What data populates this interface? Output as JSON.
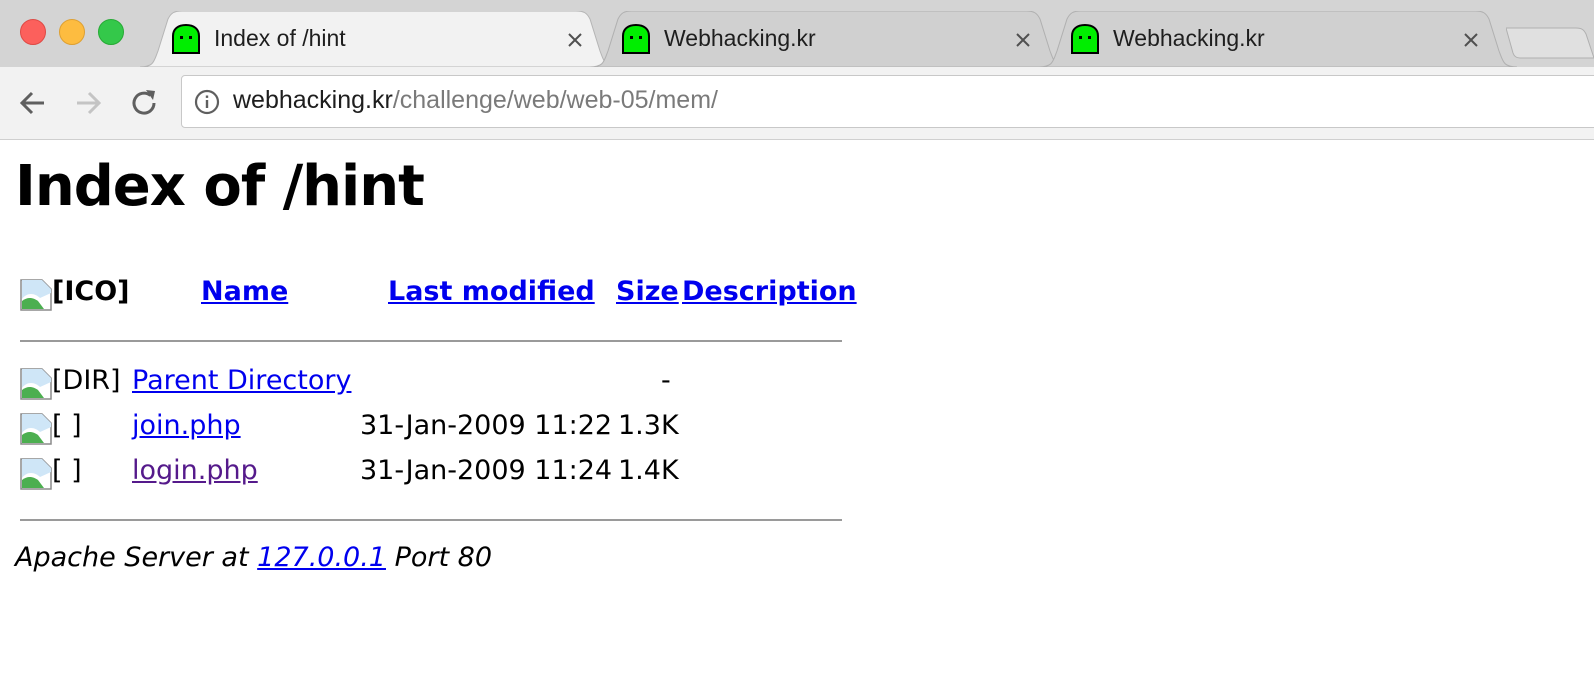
{
  "browser": {
    "tabs": [
      {
        "title": "Index of /hint",
        "active": true
      },
      {
        "title": "Webhacking.kr",
        "active": false
      },
      {
        "title": "Webhacking.kr",
        "active": false
      }
    ],
    "address_bar": {
      "host": "webhacking.kr",
      "path": "/challenge/web/web-05/mem/"
    }
  },
  "page": {
    "title": "Index of /hint",
    "table": {
      "header": {
        "icon_alt": "[ICO]",
        "name": "Name",
        "last_modified": "Last modified",
        "size": "Size",
        "description": "Description"
      },
      "rows": [
        {
          "icon_alt": "[DIR]",
          "name": "Parent Directory",
          "last_modified": "",
          "size": "-",
          "visited": false
        },
        {
          "icon_alt": "[ ]",
          "name": "join.php",
          "last_modified": "31-Jan-2009 11:22",
          "size": "1.3K",
          "visited": false
        },
        {
          "icon_alt": "[ ]",
          "name": "login.php",
          "last_modified": "31-Jan-2009 11:24",
          "size": "1.4K",
          "visited": true
        }
      ]
    },
    "footer": {
      "prefix": "Apache Server at ",
      "host": "127.0.0.1",
      "suffix": " Port 80"
    }
  },
  "colors": {
    "link": "#0000ee",
    "visited_link": "#551a8b",
    "favicon_green": "#00ee00"
  }
}
